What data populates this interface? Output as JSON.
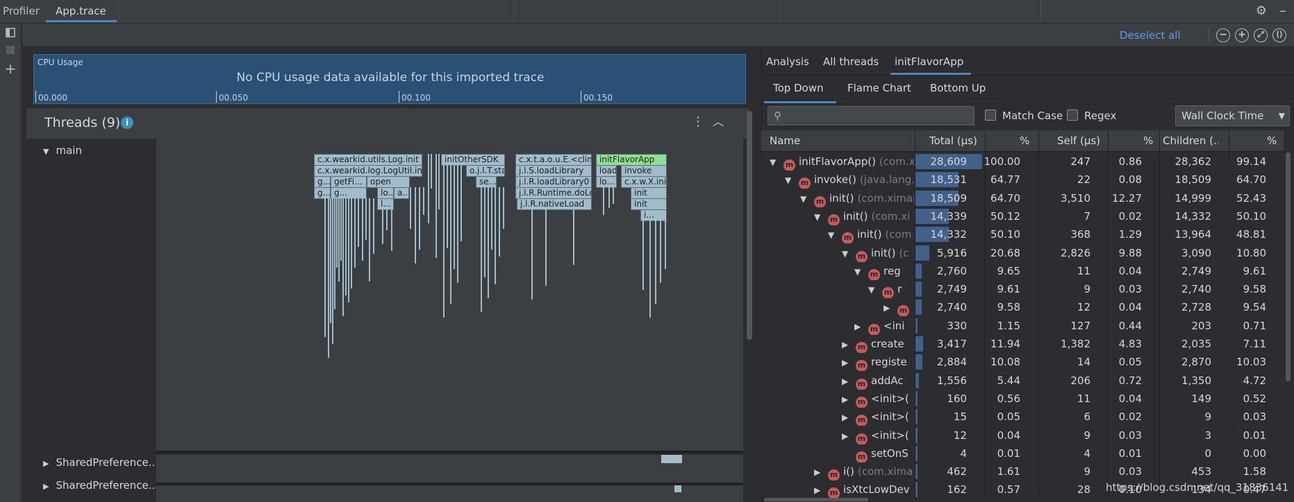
{
  "tabs": {
    "profiler": "Profiler",
    "trace": "App.trace"
  },
  "toolbar": {
    "deselect_all": "Deselect all"
  },
  "cpu": {
    "title": "CPU Usage",
    "message": "No CPU usage data available for this imported trace",
    "ticks": [
      "00.000",
      "00.050",
      "00.100",
      "00.150"
    ]
  },
  "threads": {
    "title": "Threads (9)",
    "rows": [
      "main",
      "SharedPreference...",
      "SharedPreference..."
    ]
  },
  "flame": {
    "nodes": [
      "c.x.wearkid.utils.Log.init",
      "c.x.wearkid.log.LogUtil.init",
      "g...",
      "getFi...",
      "open",
      "g...",
      "g...",
      "lo...",
      "a...",
      "l...",
      "initOtherSDK",
      "o.j.l.T.start",
      "se...",
      "c.x.t.a.o.u.E.<clinit>",
      "j.l.S.loadLibrary",
      "j.l.R.loadLibrary0",
      "j.l.R.Runtime.doLoad",
      "j.l.R.nativeLoad",
      "initFlavorApp",
      "load",
      "invoke",
      "lo...",
      "c.x.w.X.init",
      "init",
      "init",
      "i..."
    ]
  },
  "right": {
    "tabs": [
      "Analysis",
      "All threads",
      "initFlavorApp"
    ],
    "subtabs": [
      "Top Down",
      "Flame Chart",
      "Bottom Up"
    ],
    "match_case": "Match Case",
    "regex": "Regex",
    "clock": "Wall Clock Time",
    "columns": [
      "Name",
      "Total (μs)",
      "%",
      "Self (μs)",
      "%",
      "Children (...",
      "%"
    ],
    "rows": [
      {
        "name": "initFlavorApp()",
        "pkg": "(com.x",
        "total": "28,609",
        "tp": "100.00",
        "self": "247",
        "sp": "0.86",
        "children": "28,362",
        "cp": "99.14"
      },
      {
        "name": "invoke()",
        "pkg": "(java.lang.r",
        "total": "18,531",
        "tp": "64.77",
        "self": "22",
        "sp": "0.08",
        "children": "18,509",
        "cp": "64.70"
      },
      {
        "name": "init()",
        "pkg": "(com.ximal",
        "total": "18,509",
        "tp": "64.70",
        "self": "3,510",
        "sp": "12.27",
        "children": "14,999",
        "cp": "52.43"
      },
      {
        "name": "init()",
        "pkg": "(com.xi",
        "total": "14,339",
        "tp": "50.12",
        "self": "7",
        "sp": "0.02",
        "children": "14,332",
        "cp": "50.10"
      },
      {
        "name": "init()",
        "pkg": "(com",
        "total": "14,332",
        "tp": "50.10",
        "self": "368",
        "sp": "1.29",
        "children": "13,964",
        "cp": "48.81"
      },
      {
        "name": "init()",
        "pkg": "(c",
        "total": "5,916",
        "tp": "20.68",
        "self": "2,826",
        "sp": "9.88",
        "children": "3,090",
        "cp": "10.80"
      },
      {
        "name": "reg",
        "pkg": "",
        "total": "2,760",
        "tp": "9.65",
        "self": "11",
        "sp": "0.04",
        "children": "2,749",
        "cp": "9.61"
      },
      {
        "name": "r",
        "pkg": "",
        "total": "2,749",
        "tp": "9.61",
        "self": "9",
        "sp": "0.03",
        "children": "2,740",
        "cp": "9.58"
      },
      {
        "name": "",
        "pkg": "",
        "total": "2,740",
        "tp": "9.58",
        "self": "12",
        "sp": "0.04",
        "children": "2,728",
        "cp": "9.54"
      },
      {
        "name": "<ini",
        "pkg": "",
        "total": "330",
        "tp": "1.15",
        "self": "127",
        "sp": "0.44",
        "children": "203",
        "cp": "0.71"
      },
      {
        "name": "create",
        "pkg": "",
        "total": "3,417",
        "tp": "11.94",
        "self": "1,382",
        "sp": "4.83",
        "children": "2,035",
        "cp": "7.11"
      },
      {
        "name": "registe",
        "pkg": "",
        "total": "2,884",
        "tp": "10.08",
        "self": "14",
        "sp": "0.05",
        "children": "2,870",
        "cp": "10.03"
      },
      {
        "name": "addAc",
        "pkg": "",
        "total": "1,556",
        "tp": "5.44",
        "self": "206",
        "sp": "0.72",
        "children": "1,350",
        "cp": "4.72"
      },
      {
        "name": "<init>(",
        "pkg": "",
        "total": "160",
        "tp": "0.56",
        "self": "11",
        "sp": "0.04",
        "children": "149",
        "cp": "0.52"
      },
      {
        "name": "<init>(",
        "pkg": "",
        "total": "15",
        "tp": "0.05",
        "self": "6",
        "sp": "0.02",
        "children": "9",
        "cp": "0.03"
      },
      {
        "name": "<init>(",
        "pkg": "",
        "total": "12",
        "tp": "0.04",
        "self": "9",
        "sp": "0.03",
        "children": "3",
        "cp": "0.01"
      },
      {
        "name": "setOnS",
        "pkg": "",
        "total": "4",
        "tp": "0.01",
        "self": "4",
        "sp": "0.01",
        "children": "0",
        "cp": "0.00"
      },
      {
        "name": "i()",
        "pkg": "(com.xima",
        "total": "462",
        "tp": "1.61",
        "self": "9",
        "sp": "0.03",
        "children": "453",
        "cp": "1.58"
      },
      {
        "name": "isXtcLowDev",
        "pkg": "",
        "total": "162",
        "tp": "0.57",
        "self": "28",
        "sp": "0.10",
        "children": "134",
        "cp": "0.47"
      }
    ]
  },
  "watermark": "https://blog.csdn.net/qq_31836141",
  "colors": {
    "accent": "#4a88c7",
    "method_badge": "#c55c5c",
    "flame_node": "#a1bccb",
    "flame_selected": "#8fe08f"
  }
}
